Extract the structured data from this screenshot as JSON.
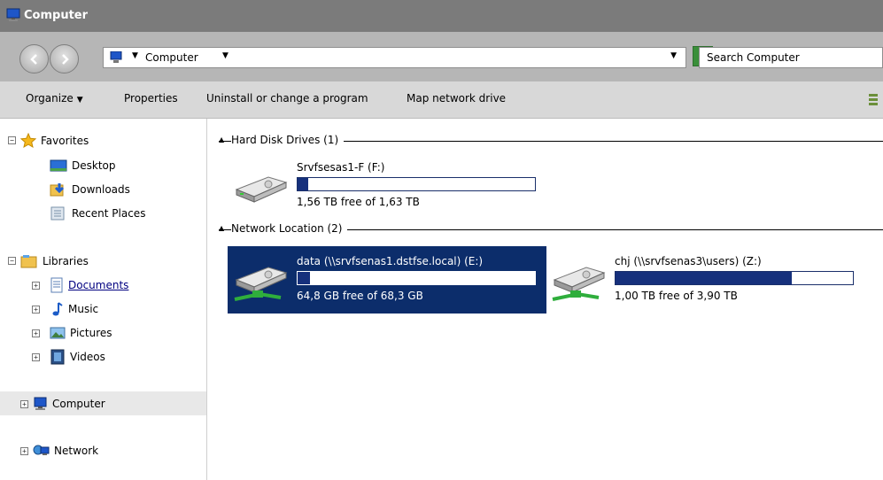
{
  "window": {
    "title": "Computer"
  },
  "address": {
    "crumb": "Computer"
  },
  "search": {
    "placeholder": "Search Computer"
  },
  "toolbar": {
    "organize": "Organize",
    "properties": "Properties",
    "uninstall": "Uninstall or change a program",
    "map_drive": "Map network drive"
  },
  "nav": {
    "favorites": "Favorites",
    "desktop": "Desktop",
    "downloads": "Downloads",
    "recent": "Recent Places",
    "libraries": "Libraries",
    "documents": "Documents",
    "music": "Music",
    "pictures": "Pictures",
    "videos": "Videos",
    "computer": "Computer",
    "network": "Network"
  },
  "groups": {
    "hdd": "Hard Disk Drives (1)",
    "network": "Network Location (2)"
  },
  "drives": [
    {
      "name": "Srvfsesas1-F (F:)",
      "free": "1,56 TB free of 1,63 TB",
      "used_fraction": 0.043
    },
    {
      "name": "data (\\\\srvfsenas1.dstfse.local) (E:)",
      "free": "64,8 GB free of 68,3 GB",
      "used_fraction": 0.051
    },
    {
      "name": "chj (\\\\srvfsenas3\\users) (Z:)",
      "free": "1,00 TB free of 3,90 TB",
      "used_fraction": 0.744
    }
  ],
  "colors": {
    "selection": "#0c2d6b",
    "bar_fill": "#16307c"
  }
}
